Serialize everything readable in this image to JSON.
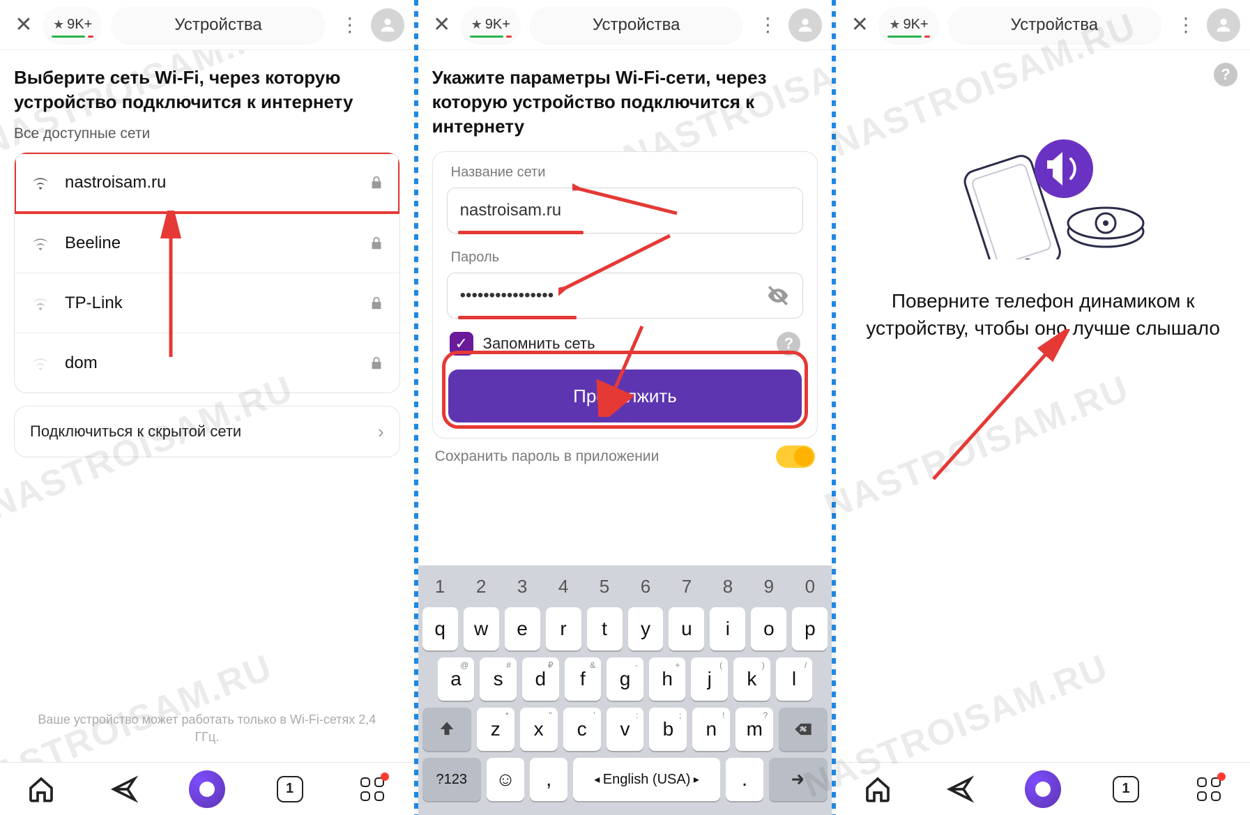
{
  "watermark": "NASTROISAM.RU",
  "topbar": {
    "rating": "9K+",
    "title": "Устройства"
  },
  "panel1": {
    "heading": "Выберите сеть Wi-Fi, через которую устройство подключится к интернету",
    "subhead": "Все доступные сети",
    "networks": [
      {
        "name": "nastroisam.ru",
        "locked": true,
        "strength": 3,
        "highlighted": true
      },
      {
        "name": "Beeline",
        "locked": true,
        "strength": 3
      },
      {
        "name": "TP-Link",
        "locked": true,
        "strength": 2
      },
      {
        "name": "dom",
        "locked": true,
        "strength": 1
      }
    ],
    "hidden_link": "Подключиться к скрытой сети",
    "footer": "Ваше устройство может работать только в Wi-Fi-сетях 2,4 ГГц."
  },
  "panel2": {
    "heading": "Укажите параметры Wi-Fi-сети, через которую устройство подключится к интернету",
    "name_label": "Название сети",
    "name_value": "nastroisam.ru",
    "pass_label": "Пароль",
    "pass_value": "••••••••••••••••",
    "remember": "Запомнить сеть",
    "continue": "Продолжить",
    "save_pwd": "Сохранить пароль в приложении",
    "keyboard": {
      "numbers": [
        "1",
        "2",
        "3",
        "4",
        "5",
        "6",
        "7",
        "8",
        "9",
        "0"
      ],
      "row1": [
        "q",
        "w",
        "e",
        "r",
        "t",
        "y",
        "u",
        "i",
        "o",
        "p"
      ],
      "row2": [
        "a",
        "s",
        "d",
        "f",
        "g",
        "h",
        "j",
        "k",
        "l"
      ],
      "row2_sup": [
        "@",
        "#",
        "₽",
        "&",
        "-",
        "+",
        "(",
        ")",
        "/"
      ],
      "row3": [
        "z",
        "x",
        "c",
        "v",
        "b",
        "n",
        "m"
      ],
      "row3_sup": [
        "*",
        "\"",
        "'",
        ":",
        ";",
        "!",
        "?"
      ],
      "sym": "?123",
      "lang": "English (USA)"
    }
  },
  "panel3": {
    "text": "Поверните телефон динамиком к устройству, чтобы оно лучше слышало"
  },
  "bottomnav": {
    "tab_count": "1"
  }
}
